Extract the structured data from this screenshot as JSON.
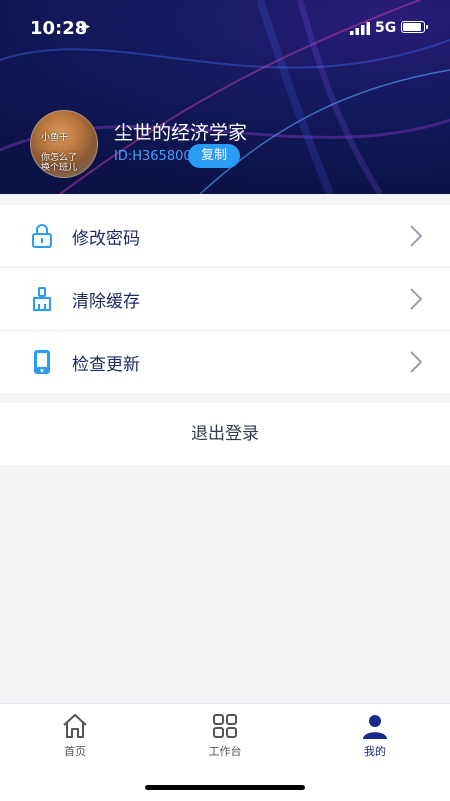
{
  "status": {
    "time": "10:28",
    "network": "5G"
  },
  "profile": {
    "avatar_caption_1": "小鱼干",
    "avatar_caption_2": "你怎么了",
    "avatar_caption_3": "换个班儿",
    "name": "尘世的经济学家",
    "id": "ID:H365800",
    "copy_label": "复制"
  },
  "menu": {
    "items": [
      {
        "label": "修改密码",
        "icon": "lock-icon"
      },
      {
        "label": "清除缓存",
        "icon": "brush-icon"
      },
      {
        "label": "检查更新",
        "icon": "phone-icon"
      }
    ]
  },
  "logout_label": "退出登录",
  "tabbar": {
    "items": [
      {
        "label": "首页",
        "icon": "home-icon"
      },
      {
        "label": "工作台",
        "icon": "grid-icon"
      },
      {
        "label": "我的",
        "icon": "person-icon",
        "active": true
      }
    ],
    "active_color": "#1b2a8a"
  },
  "colors": {
    "accent": "#2b9cf6",
    "header_bg": "#141a5e"
  }
}
